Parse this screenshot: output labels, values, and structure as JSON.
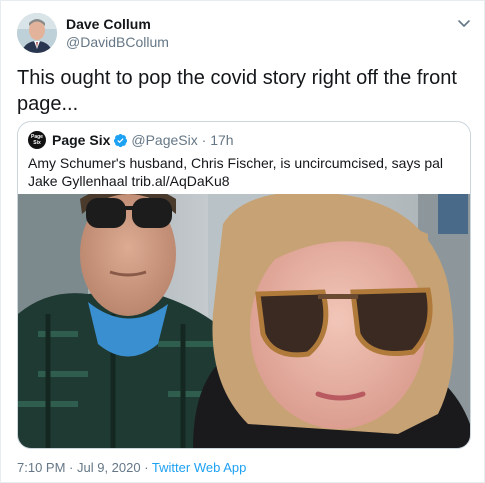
{
  "author": {
    "name": "Dave Collum",
    "handle": "@DavidBCollum"
  },
  "tweet": {
    "text": "This ought to pop the covid story right off the front page..."
  },
  "quoted": {
    "avatar_text": "Page Six",
    "name": "Page Six",
    "handle": "@PageSix",
    "separator": " · ",
    "time": "17h",
    "text": "Amy Schumer's husband, Chris Fischer, is uncircumcised, says pal Jake Gyllenhaal trib.al/AqDaKu8"
  },
  "footer": {
    "time": "7:10 PM",
    "separator1": " · ",
    "date": "Jul 9, 2020",
    "separator2": " · ",
    "app": "Twitter Web App"
  },
  "colors": {
    "link": "#1da1f2",
    "verified": "#1da1f2",
    "secondary_text": "#657786"
  }
}
